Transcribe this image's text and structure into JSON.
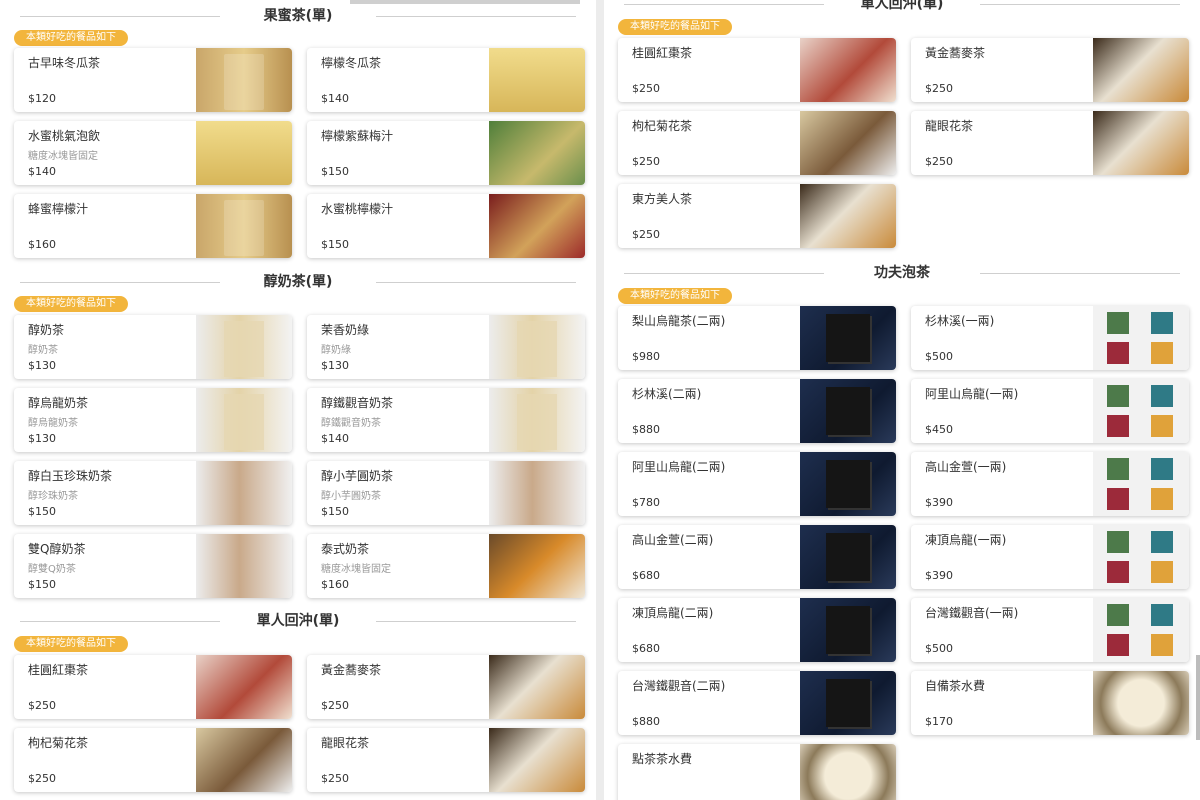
{
  "left": {
    "sections": [
      {
        "title": "果蜜茶(單)",
        "badge": "",
        "items": [
          {
            "name": "古早味冬瓜茶",
            "desc": "",
            "price": "$120",
            "thumb": "drink"
          },
          {
            "name": "檸檬冬瓜茶",
            "desc": "",
            "price": "$140",
            "thumb": "lemon"
          },
          {
            "name": "水蜜桃氣泡飲",
            "desc": "糖度冰塊皆固定",
            "price": "$140",
            "thumb": "lemon"
          },
          {
            "name": "檸檬紫蘇梅汁",
            "desc": "",
            "price": "$150",
            "thumb": "green"
          },
          {
            "name": "蜂蜜檸檬汁",
            "desc": "",
            "price": "$160",
            "thumb": "drink"
          },
          {
            "name": "水蜜桃檸檬汁",
            "desc": "",
            "price": "$150",
            "thumb": "red"
          }
        ]
      },
      {
        "title": "醇奶茶(單)",
        "badge": "本類好吃的餐品如下",
        "items": [
          {
            "name": "醇奶茶",
            "desc": "醇奶茶",
            "price": "$130",
            "thumb": "milk"
          },
          {
            "name": "茉香奶綠",
            "desc": "醇奶綠",
            "price": "$130",
            "thumb": "milk"
          },
          {
            "name": "醇烏龍奶茶",
            "desc": "醇烏龍奶茶",
            "price": "$130",
            "thumb": "milk"
          },
          {
            "name": "醇鐵觀音奶茶",
            "desc": "醇鐵觀音奶茶",
            "price": "$140",
            "thumb": "milk"
          },
          {
            "name": "醇白玉珍珠奶茶",
            "desc": "醇珍珠奶茶",
            "price": "$150",
            "thumb": "pearl"
          },
          {
            "name": "醇小芋圓奶茶",
            "desc": "醇小芋圓奶茶",
            "price": "$150",
            "thumb": "pearl"
          },
          {
            "name": "雙Q醇奶茶",
            "desc": "醇雙Q奶茶",
            "price": "$150",
            "thumb": "pearl"
          },
          {
            "name": "泰式奶茶",
            "desc": "糖度冰塊皆固定",
            "price": "$160",
            "thumb": "thai"
          }
        ]
      },
      {
        "title": "單人回沖(單)",
        "badge": "本類好吃的餐品如下",
        "items": [
          {
            "name": "桂圓紅棗茶",
            "desc": "",
            "price": "$250",
            "thumb": "tea-red"
          },
          {
            "name": "黃金蕎麥茶",
            "desc": "",
            "price": "$250",
            "thumb": "tea-gold"
          },
          {
            "name": "枸杞菊花茶",
            "desc": "",
            "price": "$250",
            "thumb": "tea-chry"
          },
          {
            "name": "龍眼花茶",
            "desc": "",
            "price": "$250",
            "thumb": "tea-gold"
          }
        ]
      }
    ],
    "top_badge": "本類好吃的餐品如下"
  },
  "right": {
    "sections": [
      {
        "title": "單人回沖(單)",
        "badge": "本類好吃的餐品如下",
        "items": [
          {
            "name": "桂圓紅棗茶",
            "desc": "",
            "price": "$250",
            "thumb": "tea-red"
          },
          {
            "name": "黃金蕎麥茶",
            "desc": "",
            "price": "$250",
            "thumb": "tea-gold"
          },
          {
            "name": "枸杞菊花茶",
            "desc": "",
            "price": "$250",
            "thumb": "tea-chry"
          },
          {
            "name": "龍眼花茶",
            "desc": "",
            "price": "$250",
            "thumb": "tea-gold"
          },
          {
            "name": "東方美人茶",
            "desc": "",
            "price": "$250",
            "thumb": "tea-gold"
          }
        ]
      },
      {
        "title": "功夫泡茶",
        "badge": "本類好吃的餐品如下",
        "items": [
          {
            "name": "梨山烏龍茶(二兩)",
            "desc": "",
            "price": "$980",
            "thumb": "box"
          },
          {
            "name": "杉林溪(一兩)",
            "desc": "",
            "price": "$500",
            "thumb": "pack"
          },
          {
            "name": "杉林溪(二兩)",
            "desc": "",
            "price": "$880",
            "thumb": "box"
          },
          {
            "name": "阿里山烏龍(一兩)",
            "desc": "",
            "price": "$450",
            "thumb": "pack"
          },
          {
            "name": "阿里山烏龍(二兩)",
            "desc": "",
            "price": "$780",
            "thumb": "box"
          },
          {
            "name": "高山金萱(一兩)",
            "desc": "",
            "price": "$390",
            "thumb": "pack"
          },
          {
            "name": "高山金萱(二兩)",
            "desc": "",
            "price": "$680",
            "thumb": "box"
          },
          {
            "name": "凍頂烏龍(一兩)",
            "desc": "",
            "price": "$390",
            "thumb": "pack"
          },
          {
            "name": "凍頂烏龍(二兩)",
            "desc": "",
            "price": "$680",
            "thumb": "box"
          },
          {
            "name": "台灣鐵觀音(一兩)",
            "desc": "",
            "price": "$500",
            "thumb": "pack"
          },
          {
            "name": "台灣鐵觀音(二兩)",
            "desc": "",
            "price": "$880",
            "thumb": "box"
          },
          {
            "name": "自備茶水費",
            "desc": "",
            "price": "$170",
            "thumb": "cup"
          },
          {
            "name": "點茶茶水費",
            "desc": "",
            "price": "",
            "thumb": "cup"
          }
        ]
      }
    ]
  }
}
